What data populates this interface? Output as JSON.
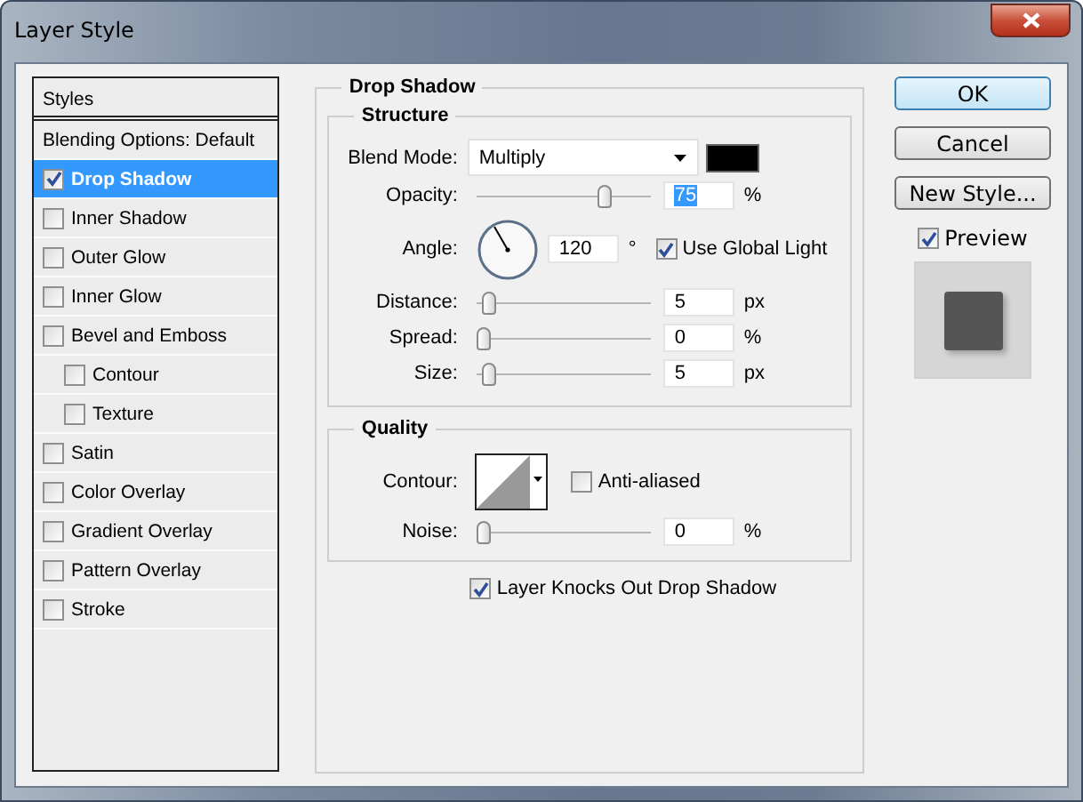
{
  "window": {
    "title": "Layer Style"
  },
  "styles_panel": {
    "header": "Styles",
    "items": [
      {
        "label": "Blending Options: Default",
        "kind": "plain",
        "selected": false
      },
      {
        "label": "Drop Shadow",
        "kind": "check",
        "checked": true,
        "selected": true
      },
      {
        "label": "Inner Shadow",
        "kind": "check",
        "checked": false,
        "selected": false
      },
      {
        "label": "Outer Glow",
        "kind": "check",
        "checked": false,
        "selected": false
      },
      {
        "label": "Inner Glow",
        "kind": "check",
        "checked": false,
        "selected": false
      },
      {
        "label": "Bevel and Emboss",
        "kind": "check",
        "checked": false,
        "selected": false,
        "children": [
          {
            "label": "Contour",
            "kind": "check",
            "checked": false,
            "selected": false
          },
          {
            "label": "Texture",
            "kind": "check",
            "checked": false,
            "selected": false
          }
        ]
      },
      {
        "label": "Satin",
        "kind": "check",
        "checked": false,
        "selected": false
      },
      {
        "label": "Color Overlay",
        "kind": "check",
        "checked": false,
        "selected": false
      },
      {
        "label": "Gradient Overlay",
        "kind": "check",
        "checked": false,
        "selected": false
      },
      {
        "label": "Pattern Overlay",
        "kind": "check",
        "checked": false,
        "selected": false
      },
      {
        "label": "Stroke",
        "kind": "check",
        "checked": false,
        "selected": false
      }
    ]
  },
  "drop_shadow": {
    "title": "Drop Shadow",
    "structure": {
      "title": "Structure",
      "blend_mode": {
        "label": "Blend Mode:",
        "value": "Multiply",
        "color": "#000000"
      },
      "opacity": {
        "label": "Opacity:",
        "level": 0.75,
        "value": "75",
        "value_selected": true,
        "unit": "%"
      },
      "angle": {
        "label": "Angle:",
        "value": "120",
        "unit": "°",
        "global_light": {
          "label": "Use Global Light",
          "checked": true
        }
      },
      "sliders": [
        {
          "label": "Distance:",
          "level": 0.03,
          "value": "5",
          "unit": "px"
        },
        {
          "label": "Spread:",
          "level": 0,
          "value": "0",
          "unit": "%"
        },
        {
          "label": "Size:",
          "level": 0.03,
          "value": "5",
          "unit": "px"
        }
      ]
    },
    "quality": {
      "title": "Quality",
      "contour_label": "Contour:",
      "anti_aliased": {
        "label": "Anti-aliased",
        "checked": false
      },
      "noise": {
        "label": "Noise:",
        "level": 0,
        "value": "0",
        "unit": "%"
      }
    },
    "knockout": {
      "label": "Layer Knocks Out Drop Shadow",
      "checked": true
    }
  },
  "buttons": [
    {
      "label": "OK",
      "default": true
    },
    {
      "label": "Cancel",
      "default": false
    },
    {
      "label": "New Style...",
      "default": false
    }
  ],
  "preview": {
    "label": "Preview",
    "checked": true
  }
}
